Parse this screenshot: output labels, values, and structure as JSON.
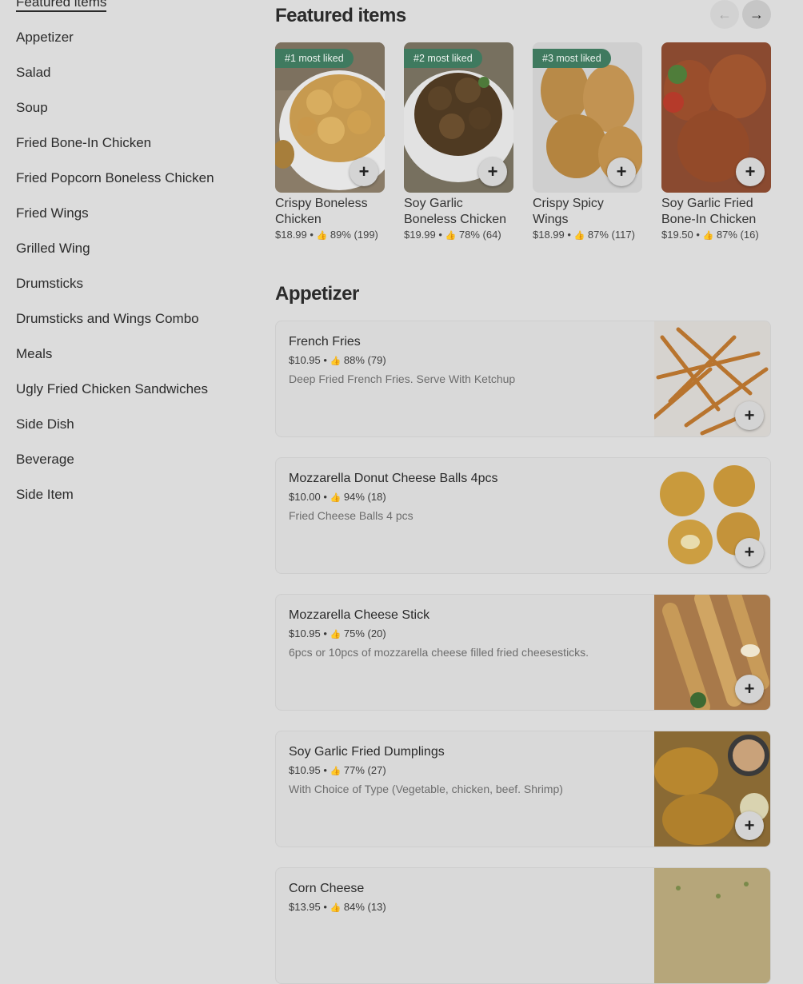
{
  "sidebar": {
    "items": [
      {
        "label": "Featured items"
      },
      {
        "label": "Appetizer"
      },
      {
        "label": "Salad"
      },
      {
        "label": "Soup"
      },
      {
        "label": "Fried Bone-In Chicken"
      },
      {
        "label": "Fried Popcorn Boneless Chicken"
      },
      {
        "label": "Fried Wings"
      },
      {
        "label": "Grilled Wing"
      },
      {
        "label": "Drumsticks"
      },
      {
        "label": "Drumsticks and Wings Combo"
      },
      {
        "label": "Meals"
      },
      {
        "label": "Ugly Fried Chicken Sandwiches"
      },
      {
        "label": "Side Dish"
      },
      {
        "label": "Beverage"
      },
      {
        "label": "Side Item"
      }
    ]
  },
  "featured": {
    "title": "Featured items",
    "prev_icon": "arrow-left-icon",
    "next_icon": "arrow-right-icon",
    "items": [
      {
        "badge": "#1 most liked",
        "name": "Crispy Boneless Chicken",
        "price": "$18.99",
        "rating": "89% (199)"
      },
      {
        "badge": "#2 most liked",
        "name": "Soy Garlic Boneless Chicken",
        "price": "$19.99",
        "rating": "78% (64)"
      },
      {
        "badge": "#3 most liked",
        "name": "Crispy Spicy Wings",
        "price": "$18.99",
        "rating": "87% (117)"
      },
      {
        "badge": "",
        "name": "Soy Garlic Fried Bone-In Chicken",
        "price": "$19.50",
        "rating": "87% (16)"
      }
    ]
  },
  "appetizer": {
    "title": "Appetizer",
    "items": [
      {
        "name": "French Fries",
        "price": "$10.95",
        "rating": "88% (79)",
        "desc": "Deep Fried French Fries. Serve With Ketchup"
      },
      {
        "name": "Mozzarella Donut Cheese Balls 4pcs",
        "price": "$10.00",
        "rating": "94% (18)",
        "desc": "Fried Cheese Balls 4 pcs"
      },
      {
        "name": "Mozzarella Cheese Stick",
        "price": "$10.95",
        "rating": "75% (20)",
        "desc": "6pcs or 10pcs of mozzarella cheese filled fried cheesesticks."
      },
      {
        "name": "Soy Garlic Fried Dumplings",
        "price": "$10.95",
        "rating": "77% (27)",
        "desc": "With Choice of Type (Vegetable, chicken, beef. Shrimp)"
      },
      {
        "name": "Corn Cheese",
        "price": "$13.95",
        "rating": "84% (13)",
        "desc": ""
      }
    ]
  },
  "ui": {
    "separator": "•",
    "thumb_glyph": "👍",
    "plus_glyph": "+",
    "prev_glyph": "←",
    "next_glyph": "→"
  }
}
